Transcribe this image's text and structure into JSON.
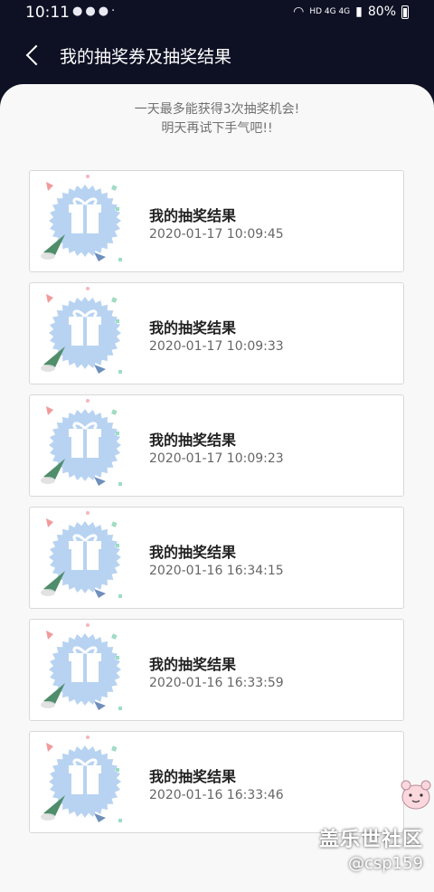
{
  "status_bar": {
    "time": "10:11",
    "notification_icons": [
      "wechat-icon",
      "wechat-icon",
      "qq-icon"
    ],
    "network": "HD 4G 4G",
    "battery": "80%"
  },
  "header": {
    "title": "我的抽奖券及抽奖结果"
  },
  "notice": {
    "line1": "一天最多能获得3次抽奖机会!",
    "line2": "明天再试下手气吧!!"
  },
  "results": [
    {
      "title": "我的抽奖结果",
      "time": "2020-01-17 10:09:45"
    },
    {
      "title": "我的抽奖结果",
      "time": "2020-01-17 10:09:33"
    },
    {
      "title": "我的抽奖结果",
      "time": "2020-01-17 10:09:23"
    },
    {
      "title": "我的抽奖结果",
      "time": "2020-01-16 16:34:15"
    },
    {
      "title": "我的抽奖结果",
      "time": "2020-01-16 16:33:59"
    },
    {
      "title": "我的抽奖结果",
      "time": "2020-01-16 16:33:46"
    }
  ],
  "watermark": {
    "title": "盖乐世社区",
    "user": "@csp159"
  },
  "colors": {
    "header_bg": "#0e1024",
    "content_bg": "#f8f8f8",
    "gift_badge": "#b7d3f1"
  }
}
